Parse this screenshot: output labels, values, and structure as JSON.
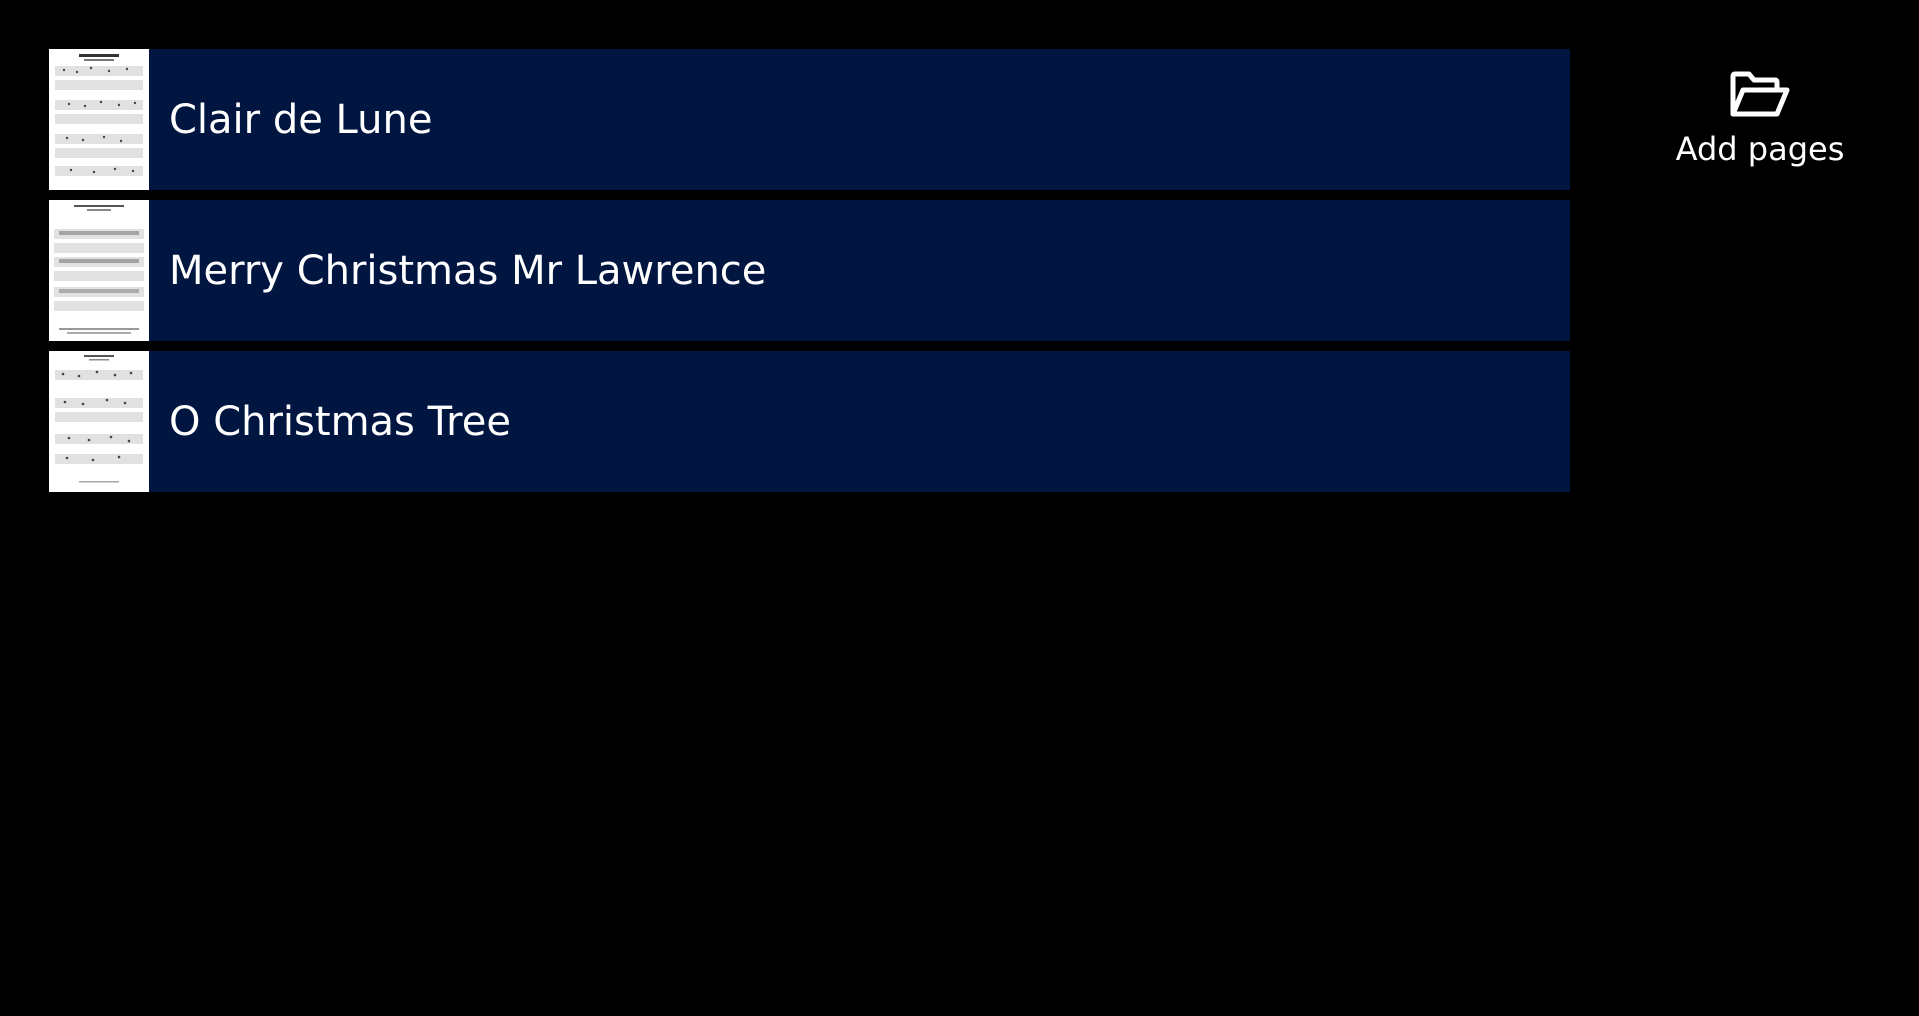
{
  "songs": [
    {
      "title": "Clair de Lune",
      "thumbnail_icon": "sheet-music-thumbnail"
    },
    {
      "title": "Merry Christmas Mr Lawrence",
      "thumbnail_icon": "sheet-music-thumbnail"
    },
    {
      "title": "O Christmas Tree",
      "thumbnail_icon": "sheet-music-thumbnail"
    }
  ],
  "add_pages": {
    "label": "Add pages",
    "icon": "folder-open-icon"
  },
  "colors": {
    "background": "#000000",
    "item_background": "#011541",
    "text": "#ffffff"
  }
}
